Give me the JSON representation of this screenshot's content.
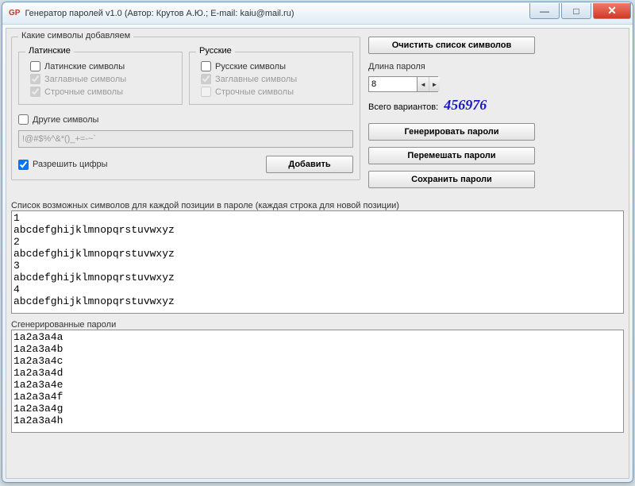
{
  "window": {
    "icon_text": "GP",
    "title": "Генератор паролей  v1.0  (Автор: Крутов А.Ю.; E-mail: kaiu@mail.ru)"
  },
  "group": {
    "which_symbols": "Какие символы добавляем",
    "latin": {
      "legend": "Латинские",
      "latin_symbols": "Латинские символы",
      "uppercase": "Заглавные символы",
      "lowercase": "Строчные символы"
    },
    "russian": {
      "legend": "Русские",
      "russian_symbols": "Русские символы",
      "uppercase": "Заглавные символы",
      "lowercase": "Строчные символы"
    },
    "other_symbols_label": "Другие символы",
    "other_symbols_value": "!@#$%^&*()_+=-~`",
    "allow_digits": "Разрешить цифры",
    "add_button": "Добавить"
  },
  "right": {
    "clear_list": "Очистить список символов",
    "length_label": "Длина пароля",
    "length_value": "8",
    "variants_label": "Всего вариантов:",
    "variants_value": "456976",
    "generate": "Генерировать пароли",
    "shuffle": "Перемешать пароли",
    "save": "Сохранить пароли"
  },
  "symbols_section": {
    "label": "Список возможных символов для каждой позиции в пароле (каждая строка для новой позиции)",
    "content": "1\nabcdefghijklmnopqrstuvwxyz\n2\nabcdefghijklmnopqrstuvwxyz\n3\nabcdefghijklmnopqrstuvwxyz\n4\nabcdefghijklmnopqrstuvwxyz"
  },
  "passwords_section": {
    "label": "Сгенерированные пароли",
    "content": "1a2a3a4a\n1a2a3a4b\n1a2a3a4c\n1a2a3a4d\n1a2a3a4e\n1a2a3a4f\n1a2a3a4g\n1a2a3a4h"
  }
}
